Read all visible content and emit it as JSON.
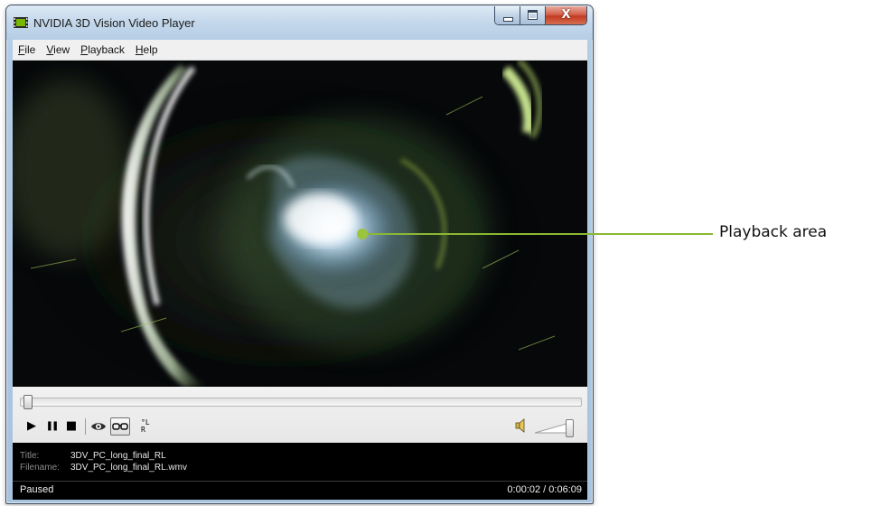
{
  "window": {
    "title": "NVIDIA 3D Vision Video Player",
    "buttons": {
      "minimize": "minimize",
      "maximize": "maximize",
      "close_glyph": "X"
    },
    "icon": "nvidia-film-icon"
  },
  "menu": {
    "items": [
      {
        "label": "File",
        "accel": "F",
        "rest": "ile"
      },
      {
        "label": "View",
        "accel": "V",
        "rest": "iew"
      },
      {
        "label": "Playback",
        "accel": "P",
        "rest": "layback"
      },
      {
        "label": "Help",
        "accel": "H",
        "rest": "elp"
      }
    ]
  },
  "video": {
    "content": "paused-frame",
    "accent_color": "#9bc53d"
  },
  "controls": {
    "seek_fraction": 0.005,
    "volume_fraction": 1.0,
    "icons": [
      "play-icon",
      "pause-icon",
      "stop-icon",
      "eye-3d-icon",
      "glasses-icon",
      "left-right-swap-icon",
      "speaker-icon"
    ],
    "play_glyph": "▶",
    "pause_glyph": "❚❚",
    "stop_glyph": "■",
    "swap_glyph": "°L R"
  },
  "info": {
    "title_label": "Title:",
    "title_value": "3DV_PC_long_final_RL",
    "filename_label": "Filename:",
    "filename_value": "3DV_PC_long_final_RL.wmv"
  },
  "status": {
    "state": "Paused",
    "time": "0:00:02 / 0:06:09"
  },
  "callout": {
    "label": "Playback area",
    "color": "#8bb833"
  }
}
